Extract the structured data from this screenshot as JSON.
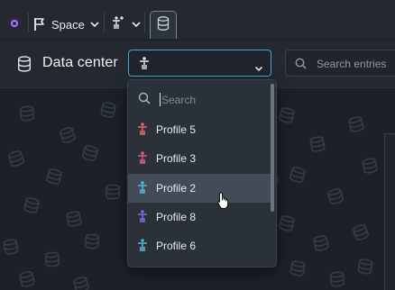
{
  "topbar": {
    "space_label": "Space"
  },
  "header": {
    "title": "Data center",
    "search": {
      "placeholder": "Search entries"
    }
  },
  "dropdown": {
    "search_placeholder": "Search",
    "items": [
      {
        "label": "Profile 5",
        "color": "#e06a6a"
      },
      {
        "label": "Profile 3",
        "color": "#d9607a"
      },
      {
        "label": "Profile 2",
        "color": "#57b6cf"
      },
      {
        "label": "Profile 8",
        "color": "#8a6ae0"
      },
      {
        "label": "Profile 6",
        "color": "#57b6cf"
      }
    ],
    "selected_index": 2
  },
  "colors": {
    "accent": "#4aa3d8",
    "brand": "#a27cff"
  }
}
